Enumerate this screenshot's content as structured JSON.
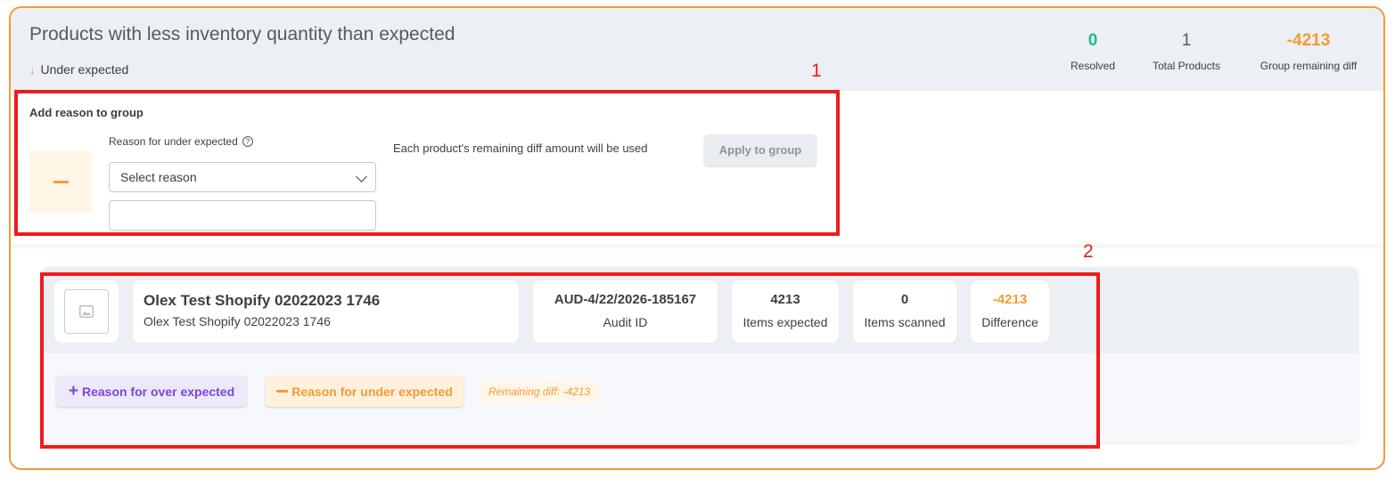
{
  "group": {
    "title": "Products with less inventory quantity than expected",
    "sub_label": "Under expected",
    "arrow_glyph": "↓"
  },
  "stats": {
    "resolved": {
      "value": "0",
      "label": "Resolved",
      "color": "#1bbc8a"
    },
    "total": {
      "value": "1",
      "label": "Total Products"
    },
    "remaining": {
      "value": "-4213",
      "label": "Group remaining diff",
      "color": "#f39a35"
    }
  },
  "reason_panel": {
    "title": "Add reason to group",
    "field_label": "Reason for under expected",
    "help_glyph": "?",
    "select_value": "Select reason",
    "note_value": "",
    "hint": "Each product's remaining diff amount will be used",
    "apply_label": "Apply to group"
  },
  "product": {
    "name": "Olex Test Shopify 02022023 1746",
    "variant": "Olex Test Shopify 02022023 1746",
    "audit_id": "AUD-4/22/2026-185167",
    "audit_id_label": "Audit ID",
    "items_expected": "4213",
    "items_expected_label": "Items expected",
    "items_scanned": "0",
    "items_scanned_label": "Items scanned",
    "difference": "-4213",
    "difference_label": "Difference"
  },
  "actions": {
    "plus_glyph": "+",
    "over_label": "Reason for over expected",
    "under_label": "Reason for under expected",
    "remaining_diff": "Remaining diff: -4213"
  },
  "annotations": {
    "one": "1",
    "two": "2"
  },
  "colors": {
    "accent_orange": "#f39a35",
    "resolved_green": "#1bbc8a",
    "over_purple": "#7a46d8",
    "annotation_red": "#ee1c1c"
  },
  "icons": [
    "arrow-down-icon",
    "help-icon",
    "chevron-down-icon",
    "minus-icon",
    "image-icon",
    "plus-icon"
  ]
}
